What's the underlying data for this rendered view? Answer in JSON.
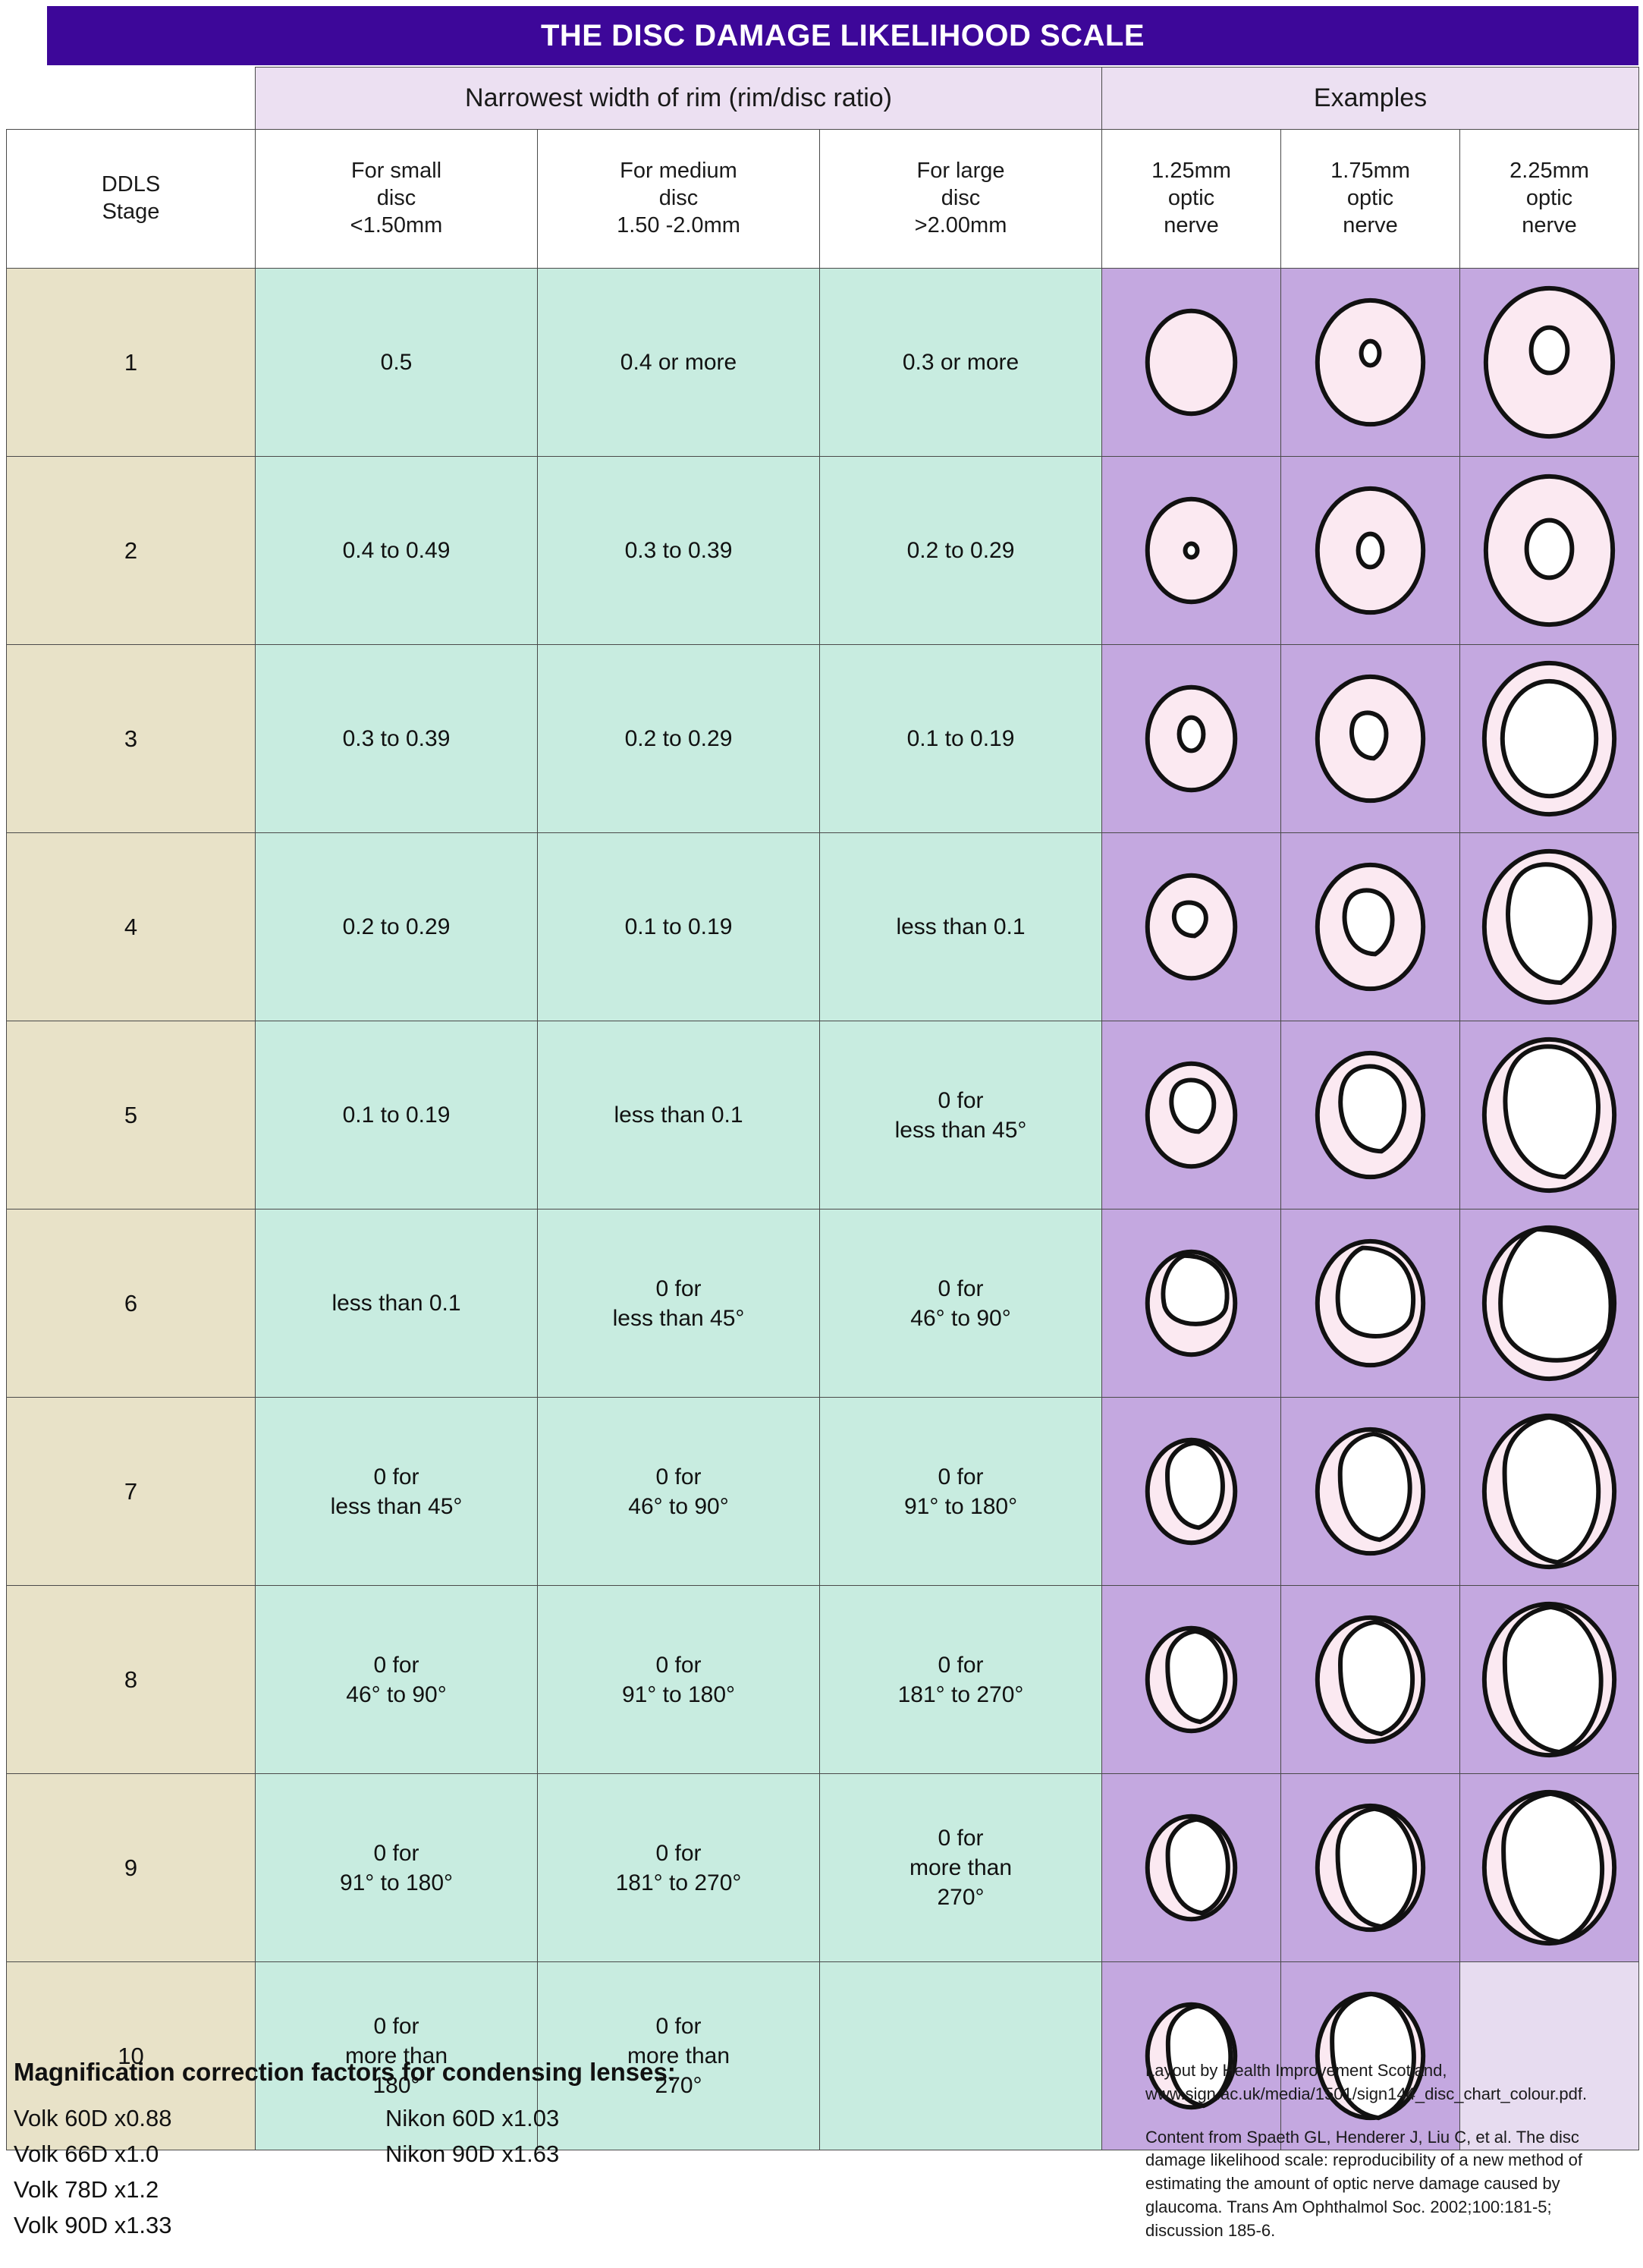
{
  "title": "THE DISC DAMAGE LIKELIHOOD SCALE",
  "accent_color": "#3d0799",
  "colors": {
    "title_bar": "#3d0799",
    "group_header": "#ece0f2",
    "stage_column": "#e8e2c8",
    "ratio_column": "#c8ece0",
    "example_column": "#c4a8e0",
    "example_empty": "#e7dcf0",
    "disc_rim": "#fbe9f1",
    "disc_cup": "#ffffff",
    "outline": "#111111"
  },
  "group_headers": {
    "rim": "Narrowest width of rim (rim/disc ratio)",
    "examples": "Examples"
  },
  "column_headers": [
    "DDLS\nStage",
    "For small\ndisc\n<1.50mm",
    "For medium\ndisc\n1.50 -2.0mm",
    "For large\ndisc\n>2.00mm",
    "1.25mm\noptic\nnerve",
    "1.75mm\noptic\nnerve",
    "2.25mm\noptic\nnerve"
  ],
  "chart_data": {
    "type": "table",
    "title": "THE DISC DAMAGE LIKELIHOOD SCALE",
    "columns": [
      "DDLS Stage",
      "For small disc <1.50mm",
      "For medium disc 1.50 -2.0mm",
      "For large disc >2.00mm",
      "1.25mm optic nerve",
      "1.75mm optic nerve",
      "2.25mm optic nerve"
    ],
    "rows": [
      {
        "stage": "1",
        "small": "0.5",
        "medium": "0.4 or more",
        "large": "0.3 or more"
      },
      {
        "stage": "2",
        "small": "0.4 to 0.49",
        "medium": "0.3 to 0.39",
        "large": "0.2 to 0.29"
      },
      {
        "stage": "3",
        "small": "0.3 to 0.39",
        "medium": "0.2 to 0.29",
        "large": "0.1 to 0.19"
      },
      {
        "stage": "4",
        "small": "0.2 to 0.29",
        "medium": "0.1 to 0.19",
        "large": "less than 0.1"
      },
      {
        "stage": "5",
        "small": "0.1 to 0.19",
        "medium": "less than 0.1",
        "large": "0 for\nless than 45°"
      },
      {
        "stage": "6",
        "small": "less than 0.1",
        "medium": "0 for\nless than 45°",
        "large": "0 for\n46° to 90°"
      },
      {
        "stage": "7",
        "small": "0 for\nless than 45°",
        "medium": "0 for\n46° to 90°",
        "large": "0 for\n91° to 180°"
      },
      {
        "stage": "8",
        "small": "0 for\n46° to 90°",
        "medium": "0 for\n91° to 180°",
        "large": "0 for\n181° to 270°"
      },
      {
        "stage": "9",
        "small": "0 for\n91° to 180°",
        "medium": "0 for\n181° to 270°",
        "large": "0 for\nmore than\n270°"
      },
      {
        "stage": "10",
        "small": "0 for\nmore than\n180°",
        "medium": "0 for\nmore than\n270°",
        "large": ""
      }
    ],
    "example_discs": [
      {
        "stage": "1",
        "nerve_125": {
          "disc_rx": 58,
          "disc_ry": 68,
          "cup_rx": 0,
          "cup_ry": 0,
          "cup_dx": 0,
          "cup_dy": -12,
          "shape": "none"
        },
        "nerve_175": {
          "disc_rx": 70,
          "disc_ry": 82,
          "cup_rx": 12,
          "cup_ry": 16,
          "cup_dx": 0,
          "cup_dy": -12,
          "shape": "ellipse"
        },
        "nerve_225": {
          "disc_rx": 84,
          "disc_ry": 98,
          "cup_rx": 24,
          "cup_ry": 30,
          "cup_dx": 0,
          "cup_dy": -16,
          "shape": "ellipse"
        }
      },
      {
        "stage": "2",
        "nerve_125": {
          "disc_rx": 58,
          "disc_ry": 68,
          "cup_rx": 8,
          "cup_ry": 9,
          "cup_dx": 0,
          "cup_dy": 0,
          "shape": "ellipse"
        },
        "nerve_175": {
          "disc_rx": 70,
          "disc_ry": 82,
          "cup_rx": 16,
          "cup_ry": 22,
          "cup_dx": 0,
          "cup_dy": 0,
          "shape": "ellipse"
        },
        "nerve_225": {
          "disc_rx": 84,
          "disc_ry": 98,
          "cup_rx": 30,
          "cup_ry": 38,
          "cup_dx": 0,
          "cup_dy": -2,
          "shape": "ellipse"
        }
      },
      {
        "stage": "3",
        "nerve_125": {
          "disc_rx": 58,
          "disc_ry": 68,
          "cup_rx": 16,
          "cup_ry": 22,
          "cup_dx": 0,
          "cup_dy": -6,
          "shape": "ellipse"
        },
        "nerve_175": {
          "disc_rx": 70,
          "disc_ry": 82,
          "cup_rx": 26,
          "cup_ry": 30,
          "cup_dx": 0,
          "cup_dy": -4,
          "shape": "blob"
        },
        "nerve_225": {
          "disc_rx": 86,
          "disc_ry": 100,
          "cup_rx": 62,
          "cup_ry": 76,
          "cup_dx": 0,
          "cup_dy": 0,
          "shape": "ellipse"
        }
      },
      {
        "stage": "4",
        "nerve_125": {
          "disc_rx": 58,
          "disc_ry": 68,
          "cup_rx": 24,
          "cup_ry": 22,
          "cup_dx": 0,
          "cup_dy": -10,
          "shape": "blob"
        },
        "nerve_175": {
          "disc_rx": 70,
          "disc_ry": 82,
          "cup_rx": 36,
          "cup_ry": 42,
          "cup_dx": 0,
          "cup_dy": -6,
          "shape": "blob"
        },
        "nerve_225": {
          "disc_rx": 86,
          "disc_ry": 100,
          "cup_rx": 62,
          "cup_ry": 78,
          "cup_dx": 4,
          "cup_dy": -4,
          "shape": "blob"
        }
      },
      {
        "stage": "5",
        "nerve_125": {
          "disc_rx": 58,
          "disc_ry": 68,
          "cup_rx": 32,
          "cup_ry": 34,
          "cup_dx": 4,
          "cup_dy": -12,
          "shape": "blob"
        },
        "nerve_175": {
          "disc_rx": 70,
          "disc_ry": 82,
          "cup_rx": 48,
          "cup_ry": 56,
          "cup_dx": 6,
          "cup_dy": -8,
          "shape": "blob"
        },
        "nerve_225": {
          "disc_rx": 86,
          "disc_ry": 100,
          "cup_rx": 70,
          "cup_ry": 86,
          "cup_dx": 8,
          "cup_dy": -4,
          "shape": "blob"
        }
      },
      {
        "stage": "6",
        "nerve_125": {
          "disc_rx": 58,
          "disc_ry": 68,
          "cup_rx": 44,
          "cup_ry": 48,
          "cup_dx": 6,
          "cup_dy": -14,
          "shape": "notch"
        },
        "nerve_175": {
          "disc_rx": 70,
          "disc_ry": 82,
          "cup_rx": 52,
          "cup_ry": 62,
          "cup_dx": 8,
          "cup_dy": -10,
          "shape": "notch"
        },
        "nerve_225": {
          "disc_rx": 86,
          "disc_ry": 100,
          "cup_rx": 76,
          "cup_ry": 92,
          "cup_dx": 10,
          "cup_dy": -4,
          "shape": "notch"
        }
      },
      {
        "stage": "7",
        "nerve_125": {
          "disc_rx": 58,
          "disc_ry": 68,
          "cup_rx": 46,
          "cup_ry": 56,
          "cup_dx": 8,
          "cup_dy": -8,
          "shape": "crescent"
        },
        "nerve_175": {
          "disc_rx": 70,
          "disc_ry": 82,
          "cup_rx": 58,
          "cup_ry": 70,
          "cup_dx": 10,
          "cup_dy": -6,
          "shape": "crescent"
        },
        "nerve_225": {
          "disc_rx": 86,
          "disc_ry": 100,
          "cup_rx": 78,
          "cup_ry": 96,
          "cup_dx": 8,
          "cup_dy": -2,
          "shape": "crescent"
        }
      },
      {
        "stage": "8",
        "nerve_125": {
          "disc_rx": 58,
          "disc_ry": 68,
          "cup_rx": 48,
          "cup_ry": 60,
          "cup_dx": 10,
          "cup_dy": -4,
          "shape": "crescent"
        },
        "nerve_175": {
          "disc_rx": 70,
          "disc_ry": 82,
          "cup_rx": 60,
          "cup_ry": 74,
          "cup_dx": 12,
          "cup_dy": -2,
          "shape": "crescent"
        },
        "nerve_225": {
          "disc_rx": 86,
          "disc_ry": 100,
          "cup_rx": 80,
          "cup_ry": 96,
          "cup_dx": 10,
          "cup_dy": 0,
          "shape": "crescent"
        }
      },
      {
        "stage": "9",
        "nerve_125": {
          "disc_rx": 58,
          "disc_ry": 68,
          "cup_rx": 50,
          "cup_ry": 62,
          "cup_dx": 12,
          "cup_dy": -2,
          "shape": "crescent"
        },
        "nerve_175": {
          "disc_rx": 70,
          "disc_ry": 82,
          "cup_rx": 64,
          "cup_ry": 78,
          "cup_dx": 12,
          "cup_dy": 0,
          "shape": "crescent"
        },
        "nerve_225": {
          "disc_rx": 86,
          "disc_ry": 100,
          "cup_rx": 82,
          "cup_ry": 98,
          "cup_dx": 10,
          "cup_dy": 0,
          "shape": "crescent"
        }
      },
      {
        "stage": "10",
        "nerve_125": {
          "disc_rx": 58,
          "disc_ry": 68,
          "cup_rx": 52,
          "cup_ry": 66,
          "cup_dx": 14,
          "cup_dy": 0,
          "shape": "crescent"
        },
        "nerve_175": {
          "disc_rx": 70,
          "disc_ry": 82,
          "cup_rx": 68,
          "cup_ry": 82,
          "cup_dx": 8,
          "cup_dy": 0,
          "shape": "crescent"
        },
        "nerve_225": null
      }
    ]
  },
  "footer": {
    "lens_heading": "Magnification correction factors for condensing lenses:",
    "lens_col_a": [
      "Volk 60D x0.88",
      "Volk 66D x1.0",
      "Volk 78D x1.2",
      "Volk 90D x1.33"
    ],
    "lens_col_b": [
      "Nikon 60D x1.03",
      "Nikon 90D x1.63"
    ],
    "layout_credit": "Layout by Health Improvement Scotland, www.sign.ac.uk/media/1501/sign144_disc_chart_colour.pdf.",
    "content_credit": "Content from Spaeth GL, Henderer J, Liu C, et al. The disc damage likelihood scale: reproducibility of a new method of estimating the amount of optic nerve damage caused by glaucoma. Trans Am Ophthalmol Soc. 2002;100:181-5; discussion 185-6."
  }
}
